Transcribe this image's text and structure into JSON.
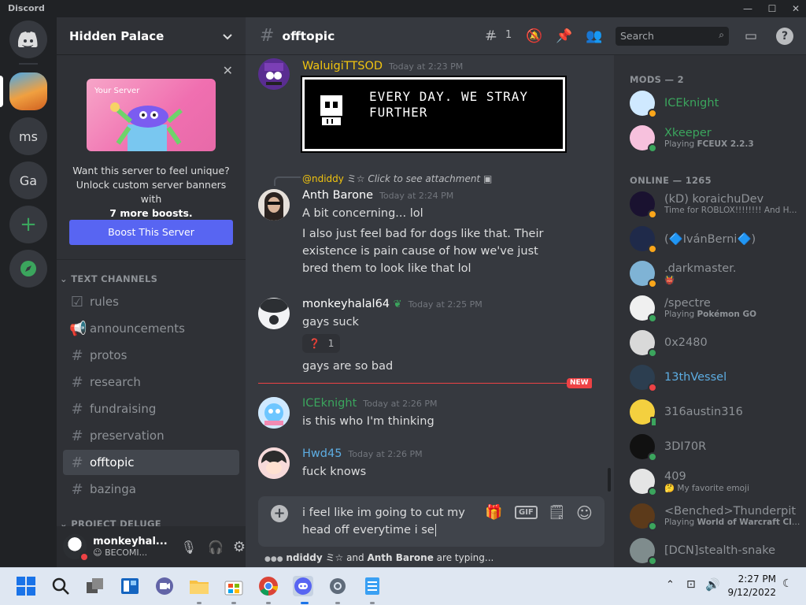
{
  "window": {
    "title": "Discord",
    "minimize": "—",
    "maximize": "☐",
    "close": "✕"
  },
  "rail": {
    "dm_icon": "discord-logo-icon",
    "guilds": [
      {
        "label": ""
      },
      {
        "label": "ms"
      },
      {
        "label": "Ga"
      }
    ],
    "add_glyph": "+",
    "explore_icon": "compass-icon"
  },
  "server": {
    "name": "Hidden Palace",
    "chevron": "⌄"
  },
  "boost": {
    "banner_label": "Your Server",
    "text_1": "Want this server to feel unique?",
    "text_2": "Unlock custom server banners with",
    "text_3": "7 more boosts.",
    "button": "Boost This Server"
  },
  "categories": [
    {
      "label": "TEXT CHANNELS"
    },
    {
      "label": "PROJECT DELUGE"
    }
  ],
  "channels": [
    {
      "label": "rules",
      "icon": "rules-icon"
    },
    {
      "label": "announcements",
      "icon": "megaphone-icon"
    },
    {
      "label": "protos",
      "icon": "hash-icon"
    },
    {
      "label": "research",
      "icon": "hash-icon"
    },
    {
      "label": "fundraising",
      "icon": "hash-icon"
    },
    {
      "label": "preservation",
      "icon": "hash-icon"
    },
    {
      "label": "offtopic",
      "icon": "hash-icon",
      "active": true
    },
    {
      "label": "bazinga",
      "icon": "hash-icon"
    }
  ],
  "user": {
    "name": "monkeyhal...",
    "status": "BECOMI...",
    "status_emoji": "☺"
  },
  "channel": {
    "name": "offtopic",
    "threads_count": "1",
    "search_placeholder": "Search"
  },
  "messages": [
    {
      "author": "WaluigiTTSOD",
      "time": "Today at 2:23 PM",
      "color": "#f1c40f",
      "image_text": "EVERY DAY. WE STRAY FURTHER"
    },
    {
      "reply_to": "@ndiddy",
      "reply_icons": "ミ☆",
      "reply_text": "Click to see attachment",
      "author": "Anth Barone",
      "time": "Today at 2:24 PM",
      "color": "#ffffff",
      "lines": [
        "A bit concerning... lol",
        "I also just feel bad for dogs like that. Their existence is pain cause of how we've just bred them to look like that lol"
      ]
    },
    {
      "author": "monkeyhalal64",
      "time": "Today at 2:25 PM",
      "color": "#ffffff",
      "line": "gays suck",
      "reaction_emoji": "❓",
      "reaction_count": "1",
      "line2": "gays are so bad"
    },
    {
      "author": "ICEknight",
      "time": "Today at 2:26 PM",
      "color": "#3ba55d",
      "line": "is this who I'm thinking"
    },
    {
      "author": "Hwd45",
      "time": "Today at 2:26 PM",
      "color": "#5dade2",
      "line": "fuck knows"
    }
  ],
  "new_badge": "NEW",
  "composer": {
    "line1": "i feel like im going to cut my",
    "line2": "head off everytime i se",
    "gif": "GIF"
  },
  "typing": {
    "dots": "●●●",
    "user1": "ndiddy",
    "icons": "ミ☆",
    "and": "and",
    "user2": "Anth Barone",
    "suffix": "are typing..."
  },
  "member_groups": [
    {
      "label": "MODS — 2",
      "members": [
        {
          "name": "ICEknight",
          "color": "#3ba55d",
          "status": "idle"
        },
        {
          "name": "Xkeeper",
          "color": "#3ba55d",
          "activity_prefix": "Playing",
          "activity": "FCEUX 2.2.3",
          "status": "online"
        }
      ]
    },
    {
      "label": "ONLINE — 1265",
      "members": [
        {
          "name": "(kD) koraichuDev",
          "activity": "Time for ROBLOX!!!!!!!! And H...",
          "status": "idle"
        },
        {
          "name": "(🔷IvánBerni🔷)",
          "status": "idle"
        },
        {
          "name": ".darkmaster.",
          "activity": "👹",
          "status": "idle"
        },
        {
          "name": "/spectre",
          "activity_prefix": "Playing",
          "activity": "Pokémon GO",
          "status": "online"
        },
        {
          "name": "0x2480",
          "status": "online"
        },
        {
          "name": "13thVessel",
          "color": "#5dade2",
          "status": "dnd"
        },
        {
          "name": "316austin316",
          "status": "mobile"
        },
        {
          "name": "3DI70R",
          "status": "online"
        },
        {
          "name": "409",
          "activity": "🤔 My favorite emoji",
          "status": "online"
        },
        {
          "name": "<Benched>Thunderpit",
          "activity_prefix": "Playing",
          "activity": "World of Warcraft Cla...",
          "status": "online"
        },
        {
          "name": "[DCN]stealth-snake",
          "status": "online"
        }
      ]
    }
  ],
  "taskbar": {
    "time": "2:27 PM",
    "date": "9/12/2022",
    "apps": [
      "start-icon",
      "search-icon",
      "task-view-icon",
      "widgets-icon",
      "teams-chat-icon",
      "file-explorer-icon",
      "store-icon",
      "chrome-icon",
      "discord-icon",
      "settings-icon",
      "notepad-icon"
    ]
  }
}
